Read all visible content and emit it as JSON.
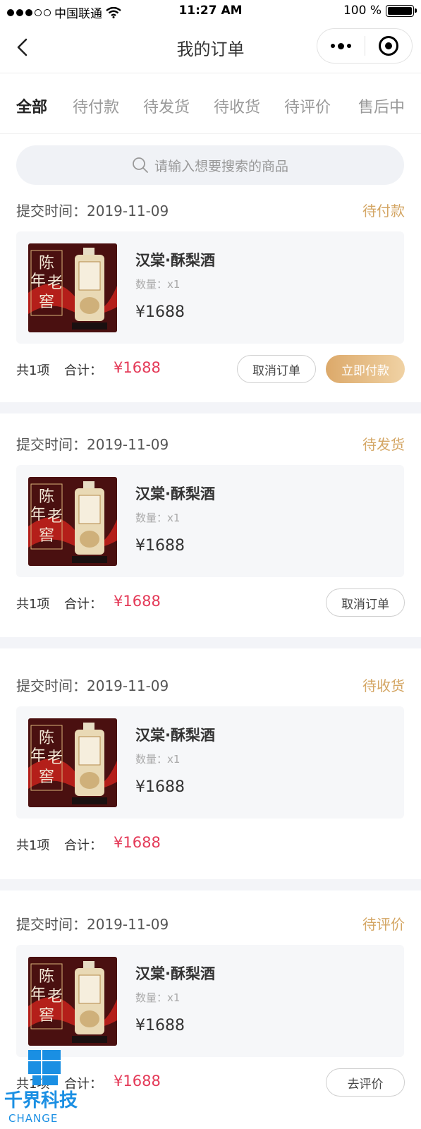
{
  "status_bar": {
    "carrier": "中国联通",
    "time": "11:27 AM",
    "battery": "100 %",
    "battery_level": 1.0
  },
  "nav": {
    "title": "我的订单"
  },
  "tabs": [
    "全部",
    "待付款",
    "待发货",
    "待收货",
    "待评价",
    "售后中"
  ],
  "active_tab": 0,
  "search": {
    "placeholder": "请输入想要搜索的商品"
  },
  "orders": [
    {
      "time": "提交时间：2019-11-09",
      "status": "待付款",
      "product": {
        "name": "汉棠·酥梨酒",
        "qty": "数量：x1",
        "price": "¥1688",
        "image_text": "陈年老窖"
      },
      "count": "共1项",
      "total_label": "合计：",
      "total": "¥1688",
      "buttons": [
        {
          "label": "取消订单",
          "style": "outline"
        },
        {
          "label": "立即付款",
          "style": "gold"
        }
      ]
    },
    {
      "time": "提交时间：2019-11-09",
      "status": "待发货",
      "product": {
        "name": "汉棠·酥梨酒",
        "qty": "数量：x1",
        "price": "¥1688",
        "image_text": "陈年老窖"
      },
      "count": "共1项",
      "total_label": "合计：",
      "total": "¥1688",
      "buttons": [
        {
          "label": "取消订单",
          "style": "outline"
        }
      ]
    },
    {
      "time": "提交时间：2019-11-09",
      "status": "待收货",
      "product": {
        "name": "汉棠·酥梨酒",
        "qty": "数量：x1",
        "price": "¥1688",
        "image_text": "陈年老窖"
      },
      "count": "共1项",
      "total_label": "合计：",
      "total": "¥1688",
      "buttons": []
    },
    {
      "time": "提交时间：2019-11-09",
      "status": "待评价",
      "product": {
        "name": "汉棠·酥梨酒",
        "qty": "数量：x1",
        "price": "¥1688",
        "image_text": "陈年老窖"
      },
      "count": "共1项",
      "total_label": "合计：",
      "total": "¥1688",
      "buttons": [
        {
          "label": "去评价",
          "style": "outline"
        }
      ]
    }
  ],
  "watermark": {
    "line1": "千界科技",
    "line2": "CHANGE"
  },
  "colors": {
    "accent_gold": "#d4a664",
    "price_red": "#e43a58",
    "card_bg": "#f6f7f9"
  }
}
